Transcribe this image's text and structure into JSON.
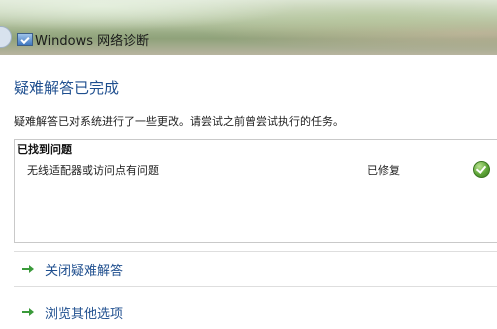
{
  "window": {
    "title": "Windows 网络诊断"
  },
  "main": {
    "heading": "疑难解答已完成",
    "description": "疑难解答已对系统进行了一些更改。请尝试之前曾尝试执行的任务。",
    "issues": {
      "header": "已找到问题",
      "rows": [
        {
          "name": "无线适配器或访问点有问题",
          "status": "已修复",
          "status_icon": "check-icon"
        }
      ]
    },
    "options": [
      {
        "label": "关闭疑难解答",
        "icon": "green-arrow-icon"
      },
      {
        "label": "浏览其他选项",
        "icon": "green-arrow-icon"
      }
    ]
  },
  "colors": {
    "heading": "#1f4f8f",
    "link": "#1f4f8f",
    "arrow": "#3a9a3a",
    "check": "#5ea538"
  }
}
